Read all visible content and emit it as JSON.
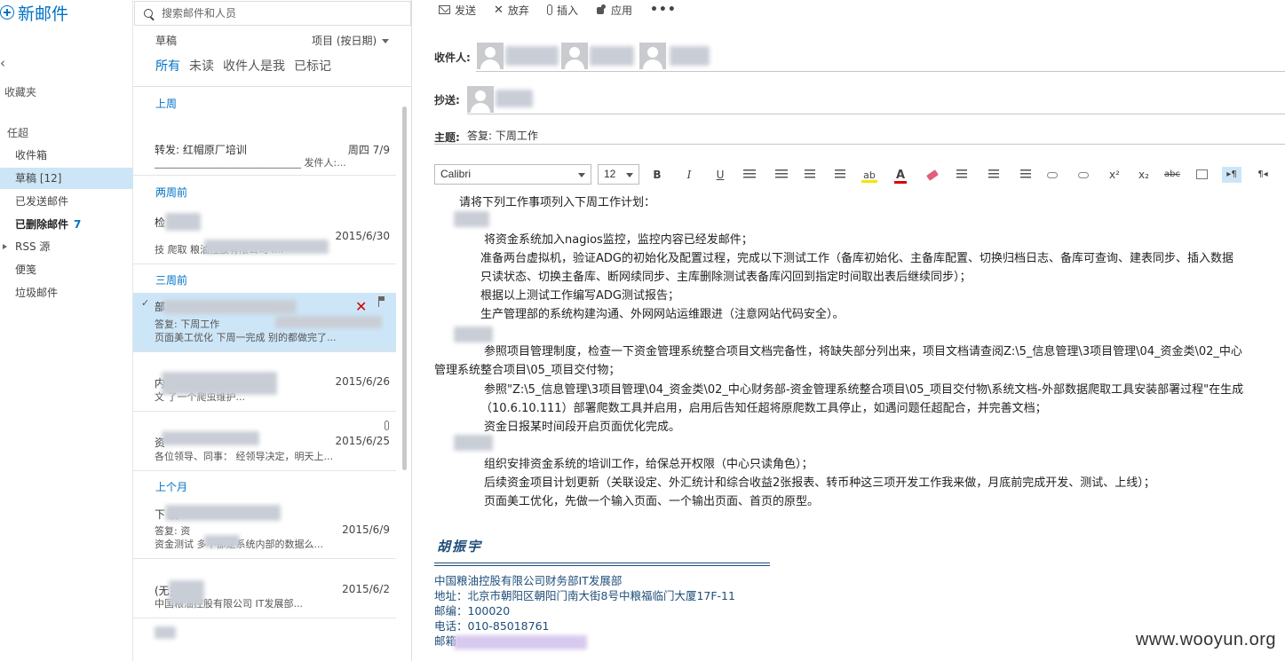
{
  "nav": {
    "new_mail": "新邮件",
    "collapse_glyph": "‹",
    "favorites": "收藏夹",
    "account": "任超",
    "items": [
      {
        "label": "收件箱",
        "count": ""
      },
      {
        "label": "草稿 [12]",
        "count": ""
      },
      {
        "label": "已发送邮件",
        "count": ""
      },
      {
        "label": "已删除邮件",
        "count": "7"
      },
      {
        "label": "RSS 源",
        "count": ""
      },
      {
        "label": "便笺",
        "count": ""
      },
      {
        "label": "垃圾邮件",
        "count": ""
      }
    ]
  },
  "list": {
    "search_placeholder": "搜索邮件和人员",
    "folder": "草稿",
    "sort": "项目 (按日期)",
    "filters": [
      "所有",
      "未读",
      "收件人是我",
      "已标记"
    ],
    "groups": [
      "上周",
      "两周前",
      "三周前",
      "上个月"
    ],
    "rows": [
      {
        "line1": "转发: 红帽原厂培训",
        "date": "周四 7/9",
        "line2": "______________________________ 发件人:..."
      },
      {
        "line1": "检",
        "date": "2015/6/30",
        "line2": "技        爬取                     粮油控股有限公司 I..."
      },
      {
        "line1": "部",
        "date": "",
        "line2a": "答复: 下周工作",
        "line2": "页面美工优化 下周一完成  别的都做完了..."
      },
      {
        "line1": "内",
        "date": "2015/6/26",
        "line2": "文                    了一个爬虫维护..."
      },
      {
        "line1": "资",
        "date": "2015/6/25",
        "line2": "各位领导、同事：  经领导决定，明天上..."
      },
      {
        "line1": "下         前",
        "date": "2015/6/9",
        "line2a": "答复: 资",
        "line2": "资金测试       多不都是系统内部的数据么..."
      },
      {
        "line1": "(无主",
        "date": "2015/6/2",
        "line2": "     中国粮油控股有限公司 IT发展部..."
      }
    ]
  },
  "compose": {
    "toolbar": [
      "发送",
      "放弃",
      "插入",
      "应用"
    ],
    "more": "•••",
    "to_label": "收件人:",
    "cc_label": "抄送:",
    "subject_label": "主题:",
    "subject": "答复: 下周工作",
    "font": "Calibri",
    "size": "12",
    "fmt": {
      "bold": "B",
      "italic": "I",
      "underline": "U",
      "superscript": "x²",
      "subscript": "x₂",
      "strike": "abc",
      "ltr": "▸¶",
      "rtl": "¶◂"
    },
    "body": [
      "请将下列工作事项列入下周工作计划：",
      "将资金系统加入nagios监控，监控内容已经发邮件；",
      "准备两台虚拟机，验证ADG的初始化及配置过程，完成以下测试工作（备库初始化、主备库配置、切换归档日志、备库可查询、建表同步、插入数据",
      "只读状态、切换主备库、断网续同步、主库删除测试表备库闪回到指定时间取出表后继续同步）；",
      "根据以上测试工作编写ADG测试报告；",
      "生产管理部的系统构建沟通、外网网站运维跟进（注意网站代码安全）。",
      "参照项目管理制度，检查一下资金管理系统整合项目文档完备性，将缺失部分列出来，项目文档请查阅Z:\\5_信息管理\\3项目管理\\04_资金类\\02_中心",
      "管理系统整合项目\\05_项目交付物；",
      "参照\"Z:\\5_信息管理\\3项目管理\\04_资金类\\02_中心财务部-资金管理系统整合项目\\05_项目交付物\\系统文档-外部数据爬取工具安装部署过程\"在生成",
      "（10.6.10.111）部署爬数工具并启用，启用后告知任超将原爬数工具停止，如遇问题任超配合，并完善文档；",
      "资金日报某时间段开启页面优化完成。",
      "组织安排资金系统的培训工作，给保总开权限（中心只读角色）；",
      "后续资金项目计划更新（关联设定、外汇统计和综合收益2张报表、转币种这三项开发工作我来做，月底前完成开发、测试、上线）；",
      "页面美工优化，先做一个输入页面、一个输出页面、首页的原型。"
    ],
    "signature": {
      "name": "胡振宇",
      "lines": [
        "中国粮油控股有限公司财务部IT发展部",
        "地址：北京市朝阳区朝阳门南大街8号中粮福临门大厦17F-11",
        "邮编：100020",
        "电话：010-85018761",
        "邮箱："
      ]
    }
  },
  "watermark": "www.wooyun.org"
}
